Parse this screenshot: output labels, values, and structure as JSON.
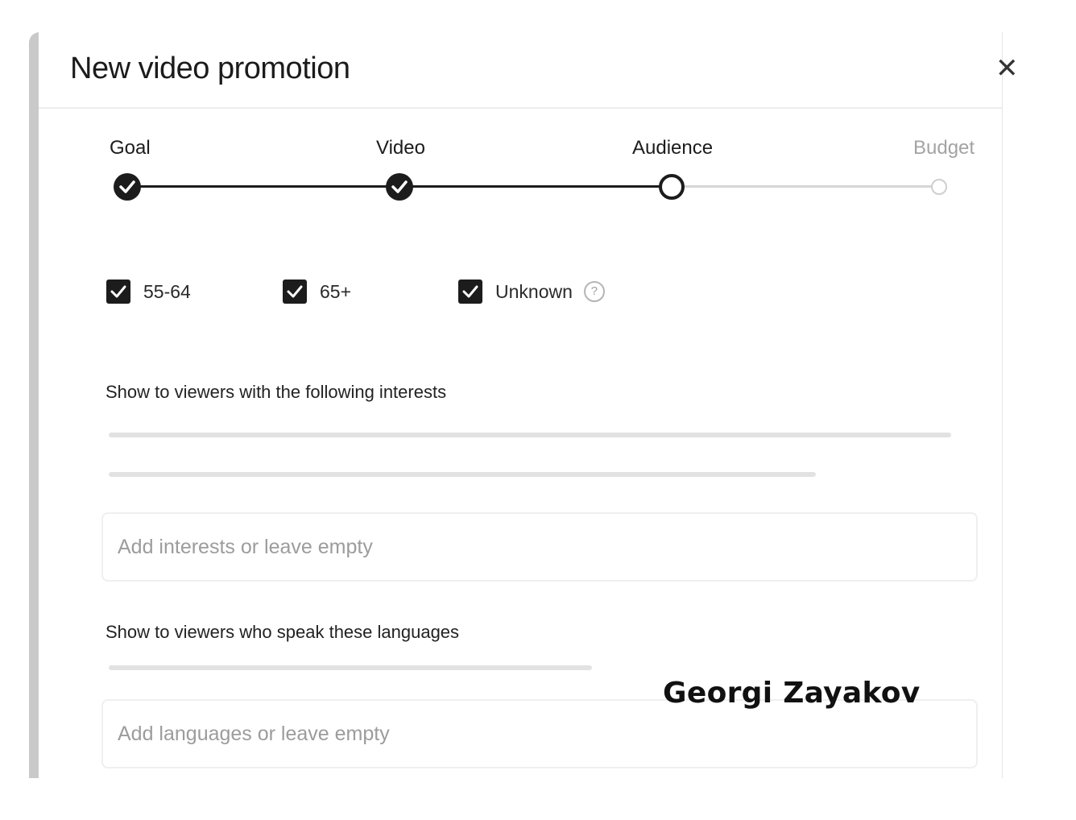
{
  "dialog": {
    "title": "New video promotion",
    "close_icon": "close-icon"
  },
  "stepper": {
    "steps": [
      {
        "label": "Goal",
        "state": "completed"
      },
      {
        "label": "Video",
        "state": "completed"
      },
      {
        "label": "Audience",
        "state": "current"
      },
      {
        "label": "Budget",
        "state": "upcoming"
      }
    ]
  },
  "age_options": [
    {
      "label": "55-64",
      "checked": true
    },
    {
      "label": "65+",
      "checked": true
    },
    {
      "label": "Unknown",
      "checked": true,
      "help_icon": "help-icon"
    }
  ],
  "interests": {
    "label": "Show to viewers with the following interests",
    "placeholder": "Add interests or leave empty",
    "value": ""
  },
  "languages": {
    "label": "Show to viewers who speak these languages",
    "placeholder": "Add languages or leave empty",
    "value": ""
  },
  "watermark": "Georgi Zayakov",
  "colors": {
    "active": "#1c1c1c",
    "inactive": "#d6d6d6",
    "placeholder_text": "#9c9c9c"
  }
}
